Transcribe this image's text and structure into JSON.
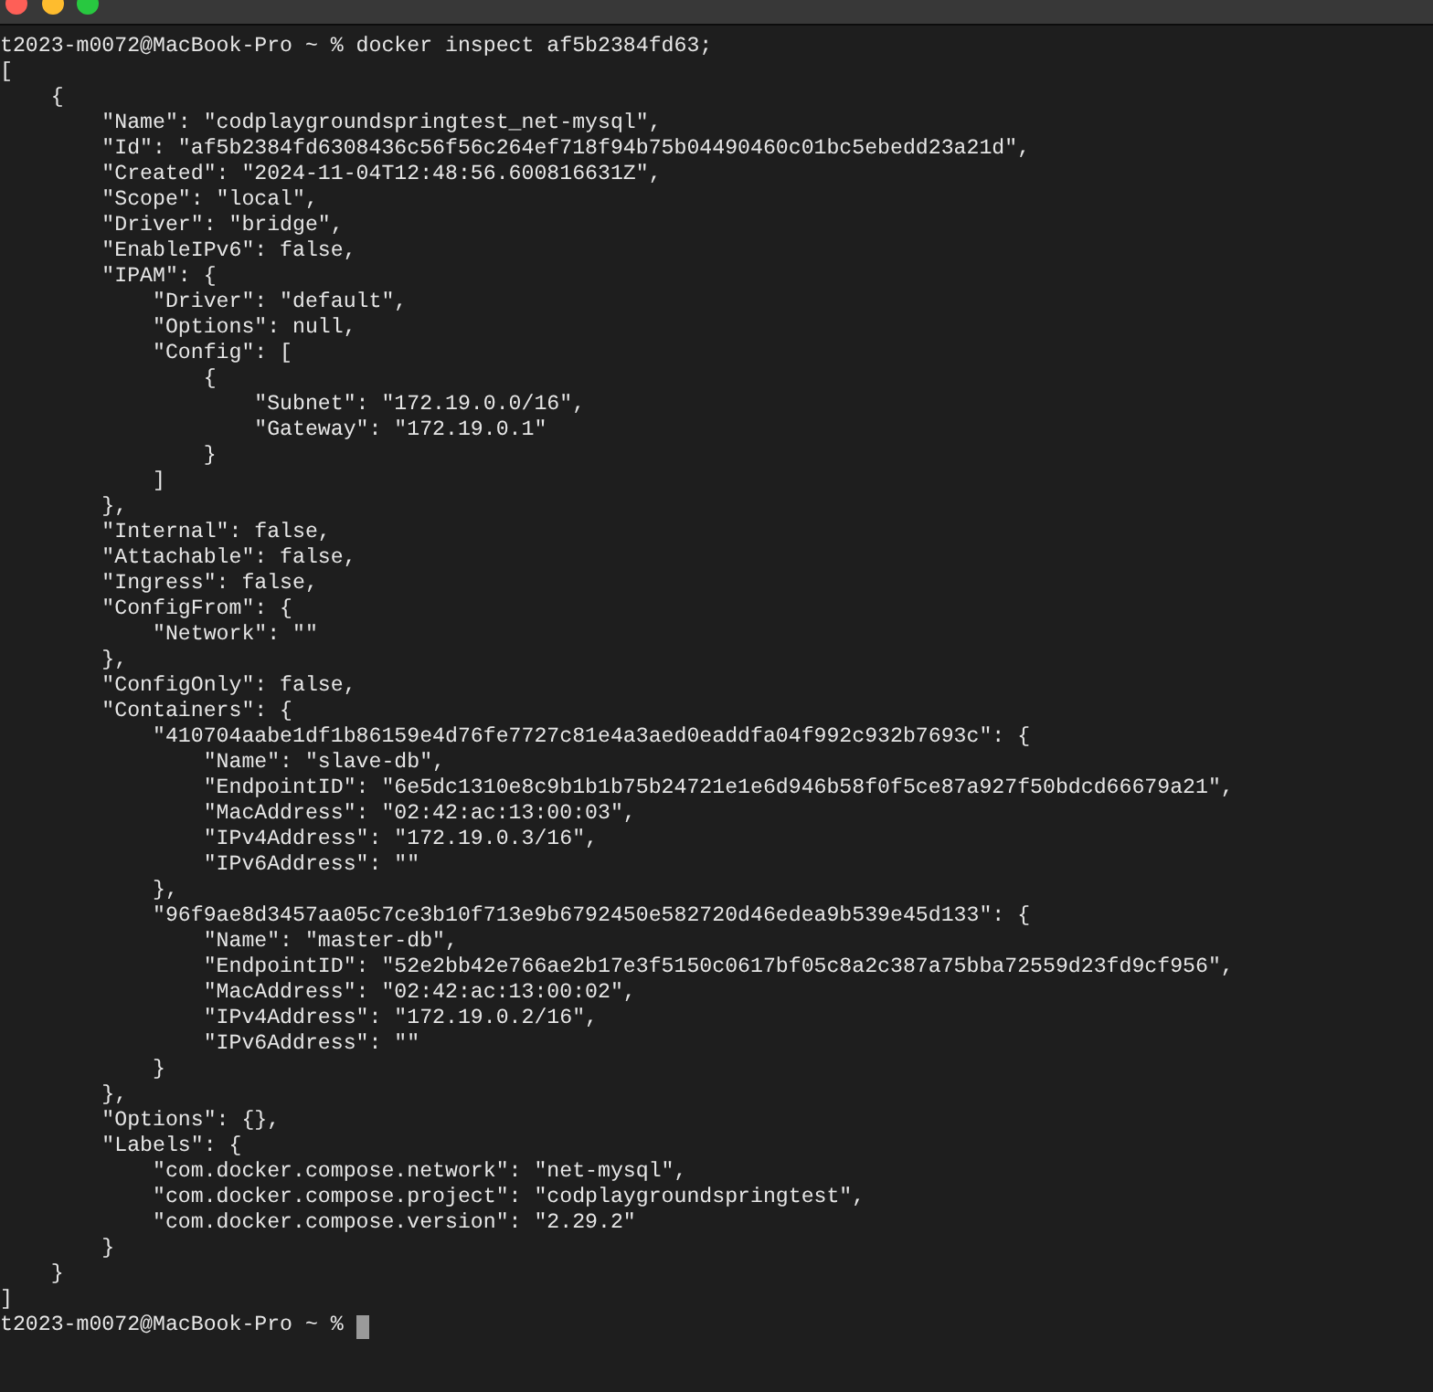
{
  "terminal": {
    "lines": [
      "t2023-m0072@MacBook-Pro ~ % docker inspect af5b2384fd63;",
      "[",
      "    {",
      "        \"Name\": \"codplaygroundspringtest_net-mysql\",",
      "        \"Id\": \"af5b2384fd6308436c56f56c264ef718f94b75b04490460c01bc5ebedd23a21d\",",
      "        \"Created\": \"2024-11-04T12:48:56.600816631Z\",",
      "        \"Scope\": \"local\",",
      "        \"Driver\": \"bridge\",",
      "        \"EnableIPv6\": false,",
      "        \"IPAM\": {",
      "            \"Driver\": \"default\",",
      "            \"Options\": null,",
      "            \"Config\": [",
      "                {",
      "                    \"Subnet\": \"172.19.0.0/16\",",
      "                    \"Gateway\": \"172.19.0.1\"",
      "                }",
      "            ]",
      "        },",
      "        \"Internal\": false,",
      "        \"Attachable\": false,",
      "        \"Ingress\": false,",
      "        \"ConfigFrom\": {",
      "            \"Network\": \"\"",
      "        },",
      "        \"ConfigOnly\": false,",
      "        \"Containers\": {",
      "            \"410704aabe1df1b86159e4d76fe7727c81e4a3aed0eaddfa04f992c932b7693c\": {",
      "                \"Name\": \"slave-db\",",
      "                \"EndpointID\": \"6e5dc1310e8c9b1b1b75b24721e1e6d946b58f0f5ce87a927f50bdcd66679a21\",",
      "                \"MacAddress\": \"02:42:ac:13:00:03\",",
      "                \"IPv4Address\": \"172.19.0.3/16\",",
      "                \"IPv6Address\": \"\"",
      "            },",
      "            \"96f9ae8d3457aa05c7ce3b10f713e9b6792450e582720d46edea9b539e45d133\": {",
      "                \"Name\": \"master-db\",",
      "                \"EndpointID\": \"52e2bb42e766ae2b17e3f5150c0617bf05c8a2c387a75bba72559d23fd9cf956\",",
      "                \"MacAddress\": \"02:42:ac:13:00:02\",",
      "                \"IPv4Address\": \"172.19.0.2/16\",",
      "                \"IPv6Address\": \"\"",
      "            }",
      "        },",
      "        \"Options\": {},",
      "        \"Labels\": {",
      "            \"com.docker.compose.network\": \"net-mysql\",",
      "            \"com.docker.compose.project\": \"codplaygroundspringtest\",",
      "            \"com.docker.compose.version\": \"2.29.2\"",
      "        }",
      "    }",
      "]"
    ],
    "prompt": "t2023-m0072@MacBook-Pro ~ %"
  }
}
